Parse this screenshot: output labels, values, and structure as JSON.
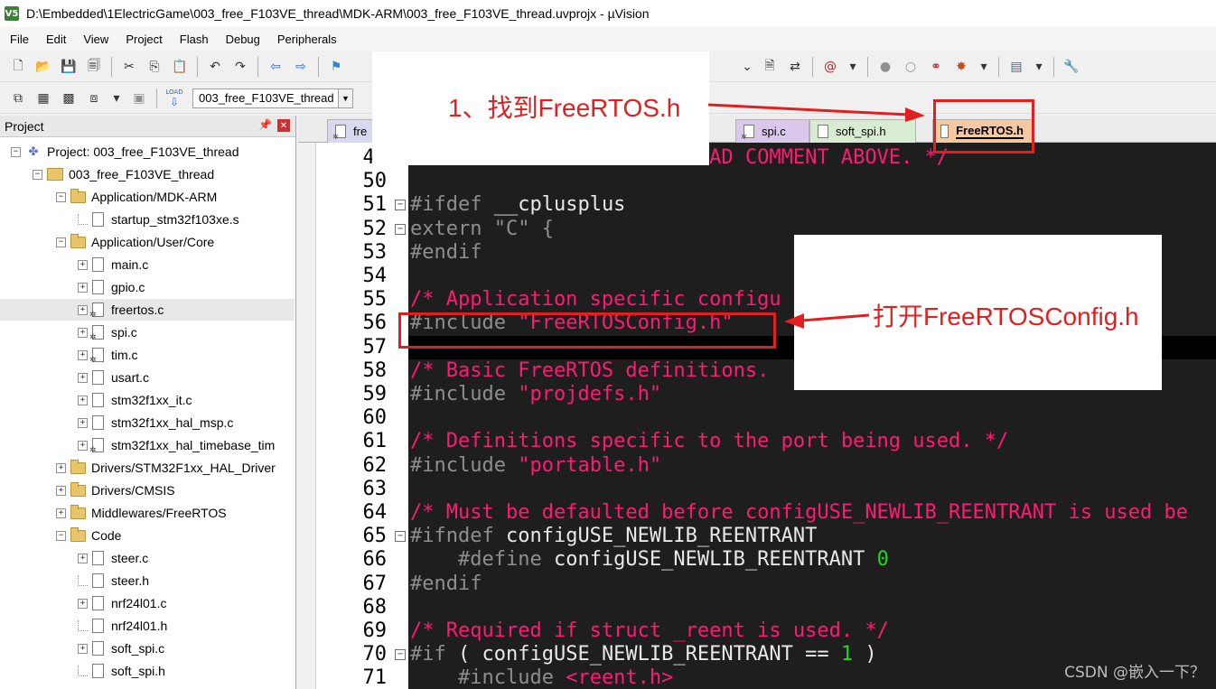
{
  "window": {
    "title": "D:\\Embedded\\1ElectricGame\\003_free_F103VE_thread\\MDK-ARM\\003_free_F103VE_thread.uvprojx - µVision",
    "app_icon_label": "V5"
  },
  "menu": {
    "items": [
      "File",
      "Edit",
      "View",
      "Project",
      "Flash",
      "Debug",
      "Peripherals"
    ]
  },
  "toolbar": {
    "target_name": "003_free_F103VE_thread",
    "load_label": "LOAD"
  },
  "project_panel": {
    "title": "Project",
    "tree": [
      {
        "label": "Project: 003_free_F103VE_thread",
        "kind": "project",
        "expander": "-"
      },
      {
        "label": "003_free_F103VE_thread",
        "kind": "target",
        "expander": "-"
      },
      {
        "label": "Application/MDK-ARM",
        "kind": "folder",
        "expander": "-"
      },
      {
        "label": "startup_stm32f103xe.s",
        "kind": "file",
        "expander": ""
      },
      {
        "label": "Application/User/Core",
        "kind": "folder",
        "expander": "-"
      },
      {
        "label": "main.c",
        "kind": "file",
        "expander": "+"
      },
      {
        "label": "gpio.c",
        "kind": "file",
        "expander": "+"
      },
      {
        "label": "freertos.c",
        "kind": "file-gear",
        "expander": "+",
        "selected": true
      },
      {
        "label": "spi.c",
        "kind": "file-gear",
        "expander": "+"
      },
      {
        "label": "tim.c",
        "kind": "file-gear",
        "expander": "+"
      },
      {
        "label": "usart.c",
        "kind": "file",
        "expander": "+"
      },
      {
        "label": "stm32f1xx_it.c",
        "kind": "file",
        "expander": "+"
      },
      {
        "label": "stm32f1xx_hal_msp.c",
        "kind": "file",
        "expander": "+"
      },
      {
        "label": "stm32f1xx_hal_timebase_tim",
        "kind": "file-gear",
        "expander": "+"
      },
      {
        "label": "Drivers/STM32F1xx_HAL_Driver",
        "kind": "folder",
        "expander": "+"
      },
      {
        "label": "Drivers/CMSIS",
        "kind": "folder",
        "expander": "+"
      },
      {
        "label": "Middlewares/FreeRTOS",
        "kind": "folder-gear",
        "expander": "+"
      },
      {
        "label": "Code",
        "kind": "folder",
        "expander": "-"
      },
      {
        "label": "steer.c",
        "kind": "file",
        "expander": "+"
      },
      {
        "label": "steer.h",
        "kind": "file",
        "expander": ""
      },
      {
        "label": "nrf24l01.c",
        "kind": "file",
        "expander": "+"
      },
      {
        "label": "nrf24l01.h",
        "kind": "file",
        "expander": ""
      },
      {
        "label": "soft_spi.c",
        "kind": "file",
        "expander": "+"
      },
      {
        "label": "soft_spi.h",
        "kind": "file",
        "expander": ""
      }
    ]
  },
  "tabs": [
    {
      "label": "fre",
      "icon": "file-gear",
      "color": "#d8d8f0"
    },
    {
      "label": "spi.c",
      "icon": "file-gear",
      "color": "#d9c8ec"
    },
    {
      "label": "soft_spi.h",
      "icon": "file",
      "color": "#d7ecd0"
    },
    {
      "label": "FreeRTOS.h",
      "icon": "file",
      "color": "#f6c8a0",
      "active": true
    }
  ],
  "editor": {
    "lines": [
      {
        "num": "49",
        "html": "<span class='c-comment'>#include \"stdint.h\" /* READ COMMENT ABOVE. */</span>"
      },
      {
        "num": "50",
        "html": ""
      },
      {
        "num": "51",
        "html": "<span class='c-pre'>#ifdef</span> <span class='c-ident'>__cplusplus</span>",
        "fold": "-"
      },
      {
        "num": "52",
        "html": "<span class='c-kw'>extern</span> <span class='c-pre'>\"C\"</span> <span class='c-pre'>{</span>",
        "fold": "-"
      },
      {
        "num": "53",
        "html": "<span class='c-pre'>#endif</span>"
      },
      {
        "num": "54",
        "html": ""
      },
      {
        "num": "55",
        "html": "<span class='c-comment'>/* Application specific configu</span>"
      },
      {
        "num": "56",
        "html": "<span class='c-pre'>#include</span> <span class='c-string'>\"FreeRTOSConfig.h\"</span>"
      },
      {
        "num": "57",
        "html": ""
      },
      {
        "num": "58",
        "html": "<span class='c-comment'>/* Basic FreeRTOS definitions.</span>"
      },
      {
        "num": "59",
        "html": "<span class='c-pre'>#include</span> <span class='c-string'>\"projdefs.h\"</span>"
      },
      {
        "num": "60",
        "html": ""
      },
      {
        "num": "61",
        "html": "<span class='c-comment'>/* Definitions specific to the port being used. */</span>"
      },
      {
        "num": "62",
        "html": "<span class='c-pre'>#include</span> <span class='c-string'>\"portable.h\"</span>"
      },
      {
        "num": "63",
        "html": ""
      },
      {
        "num": "64",
        "html": "<span class='c-comment'>/* Must be defaulted before configUSE_NEWLIB_REENTRANT is used be</span>"
      },
      {
        "num": "65",
        "html": "<span class='c-pre'>#ifndef</span> <span class='c-ident'>configUSE_NEWLIB_REENTRANT</span>",
        "fold": "-"
      },
      {
        "num": "66",
        "html": "    <span class='c-pre'>#define</span> <span class='c-ident'>configUSE_NEWLIB_REENTRANT</span> <span class='c-num'>0</span>"
      },
      {
        "num": "67",
        "html": "<span class='c-pre'>#endif</span>"
      },
      {
        "num": "68",
        "html": ""
      },
      {
        "num": "69",
        "html": "<span class='c-comment'>/* Required if struct _reent is used. */</span>"
      },
      {
        "num": "70",
        "html": "<span class='c-pre'>#if</span> <span class='c-ident'>( configUSE_NEWLIB_REENTRANT == </span><span class='c-num'>1</span><span class='c-ident'> )</span>",
        "fold": "-"
      },
      {
        "num": "71",
        "html": "    <span class='c-pre'>#include</span> <span class='c-string'>&lt;reent.h&gt;</span>"
      }
    ]
  },
  "annotations": {
    "step1": "1、找到FreeRTOS.h",
    "step2": "打开FreeRTOSConfig.h",
    "color": "#e02020"
  },
  "watermark": "CSDN @嵌入一下？"
}
